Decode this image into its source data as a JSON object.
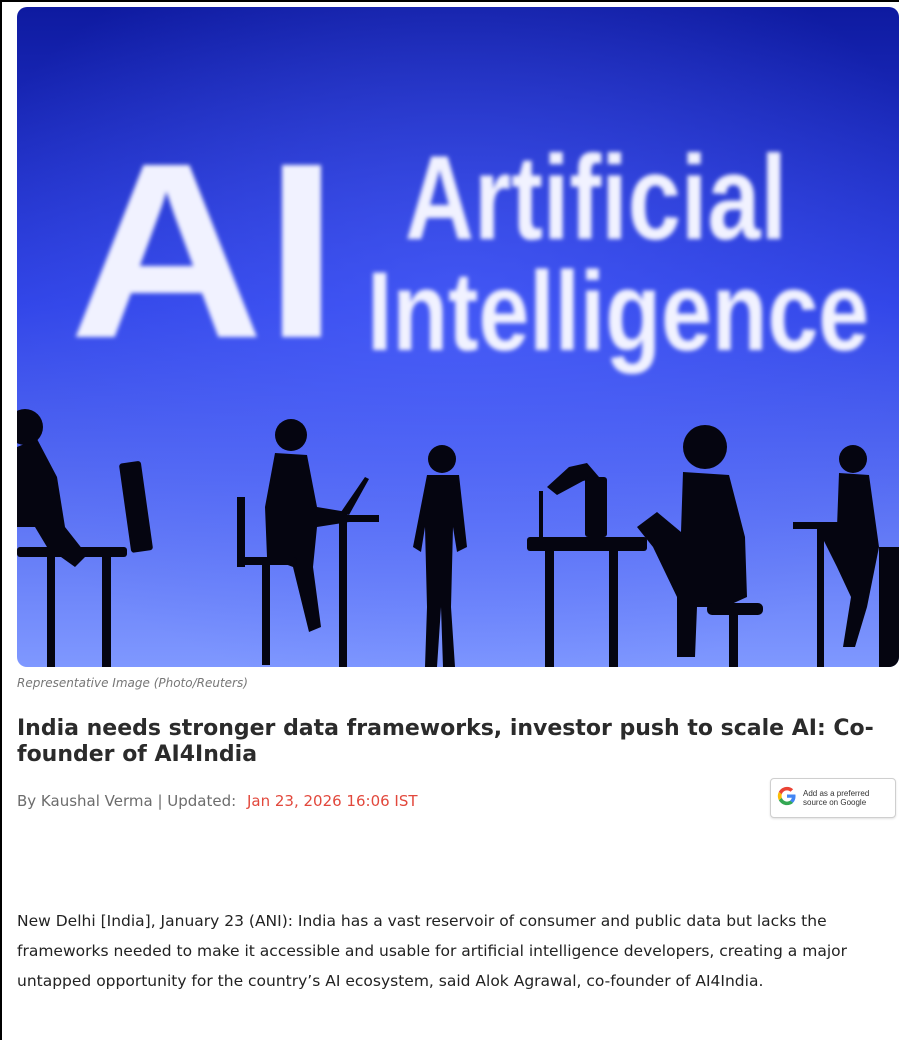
{
  "hero": {
    "ai_text": "AI",
    "line1": "Artificial",
    "line2": "Intelligence",
    "caption": "Representative Image (Photo/Reuters)",
    "colors": {
      "bg_top": "#0e1aa0",
      "bg_mid": "#2f43e6",
      "bg_bottom": "#7f98ff",
      "silhouette": "#050510"
    }
  },
  "article": {
    "headline": "India needs stronger data frameworks, investor push to scale AI: Co-founder of AI4India",
    "byline_prefix": "By Kaushal Verma | Updated:",
    "date": "Jan 23, 2026 16:06 IST",
    "body": "New Delhi [India], January 23 (ANI): India has a vast reservoir of consumer and public data but lacks the frameworks needed to make it accessible and usable for artificial intelligence developers, creating a major untapped opportunity for the country’s AI ecosystem, said Alok Agrawal, co-founder of AI4India."
  },
  "google_badge": {
    "text": "Add as a preferred source on Google",
    "icon": "google-g-icon"
  }
}
